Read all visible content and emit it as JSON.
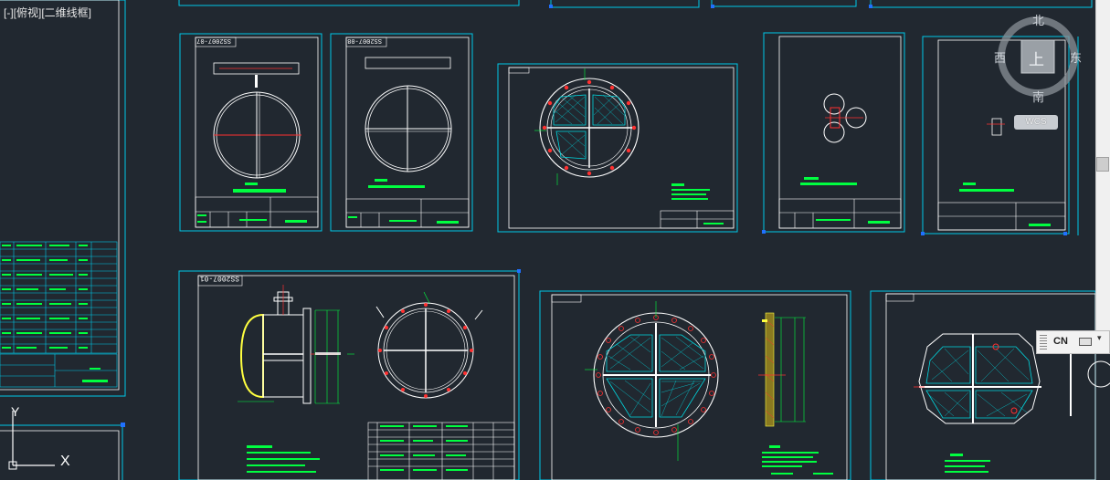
{
  "viewport": {
    "label": "[-][俯视][二维线框]"
  },
  "viewcube": {
    "north": "北",
    "south": "南",
    "west": "西",
    "east": "东",
    "top_face": "上",
    "wcs_label": "WCS"
  },
  "ucs": {
    "x_label": "X",
    "y_label": "Y"
  },
  "ime": {
    "lang": "CN"
  },
  "drawings": {
    "sheet_ids": [
      "SS2007-07",
      "SS2007-08",
      "SS2007-01"
    ]
  },
  "colors": {
    "background": "#212830",
    "sheet_border": "#00c8e8",
    "geometry": "#ffffff",
    "center_line": "#ff3030",
    "mesh": "#00d8e0",
    "annotation": "#00ff40",
    "shell_fill": "#ffff40",
    "viewcube_face": "#9aa0a6"
  }
}
